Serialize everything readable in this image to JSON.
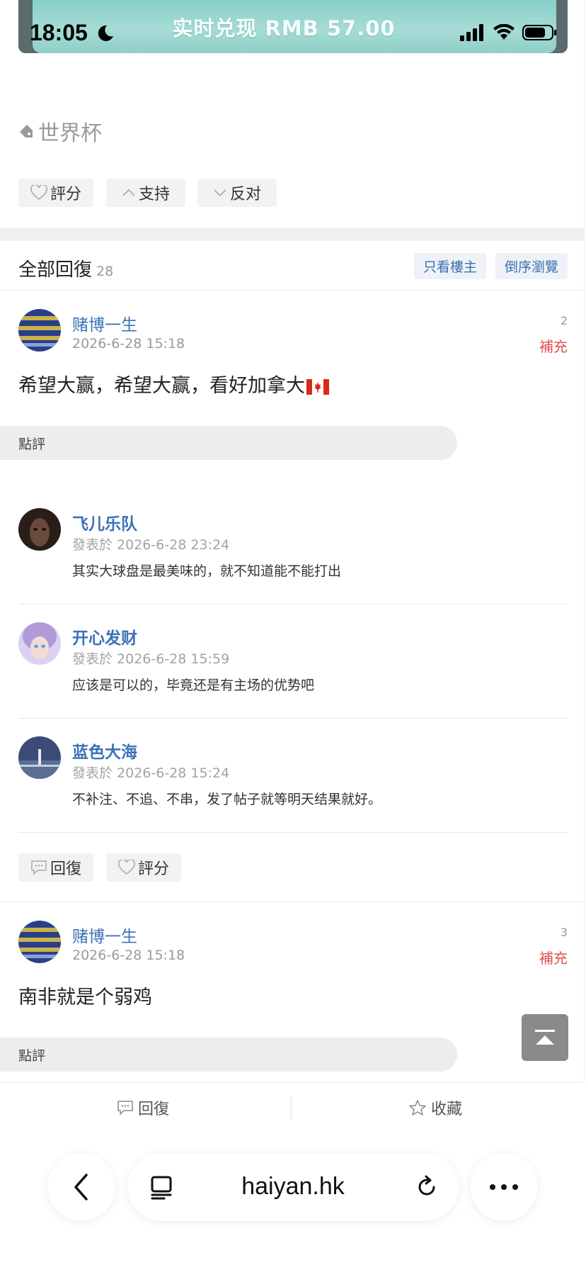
{
  "status_bar": {
    "time": "18:05"
  },
  "banner": {
    "text": "实时兑现  RMB 57.00"
  },
  "tag": {
    "label": "世界杯"
  },
  "post_actions": {
    "rate": "評分",
    "support": "支持",
    "oppose": "反对"
  },
  "replies_header": {
    "title": "全部回復",
    "count": "28",
    "only_author": "只看樓主",
    "reverse_order": "倒序瀏覽"
  },
  "posts": [
    {
      "author": "赌博一生",
      "time": "2026-6-28 15:18",
      "floor": "2",
      "supplement": "補充",
      "body": "希望大赢，希望大赢，看好加拿大",
      "comment_label": "點評"
    },
    {
      "author": "赌博一生",
      "time": "2026-6-28 15:18",
      "floor": "3",
      "supplement": "補充",
      "body": "南非就是个弱鸡",
      "comment_label": "點評"
    }
  ],
  "comments": [
    {
      "author": "飞儿乐队",
      "time": "發表於 2026-6-28 23:24",
      "body": "其实大球盘是最美味的，就不知道能不能打出"
    },
    {
      "author": "开心发财",
      "time": "發表於 2026-6-28 15:59",
      "body": "应该是可以的，毕竟还是有主场的优势吧"
    },
    {
      "author": "蓝色大海",
      "time": "發表於 2026-6-28 15:24",
      "body": "不补注、不追、不串，发了帖子就等明天结果就好。"
    }
  ],
  "reply_actions": {
    "reply": "回復",
    "rate": "評分"
  },
  "bottom_bar": {
    "reply": "回復",
    "favorite": "收藏"
  },
  "browser": {
    "url": "haiyan.hk"
  }
}
